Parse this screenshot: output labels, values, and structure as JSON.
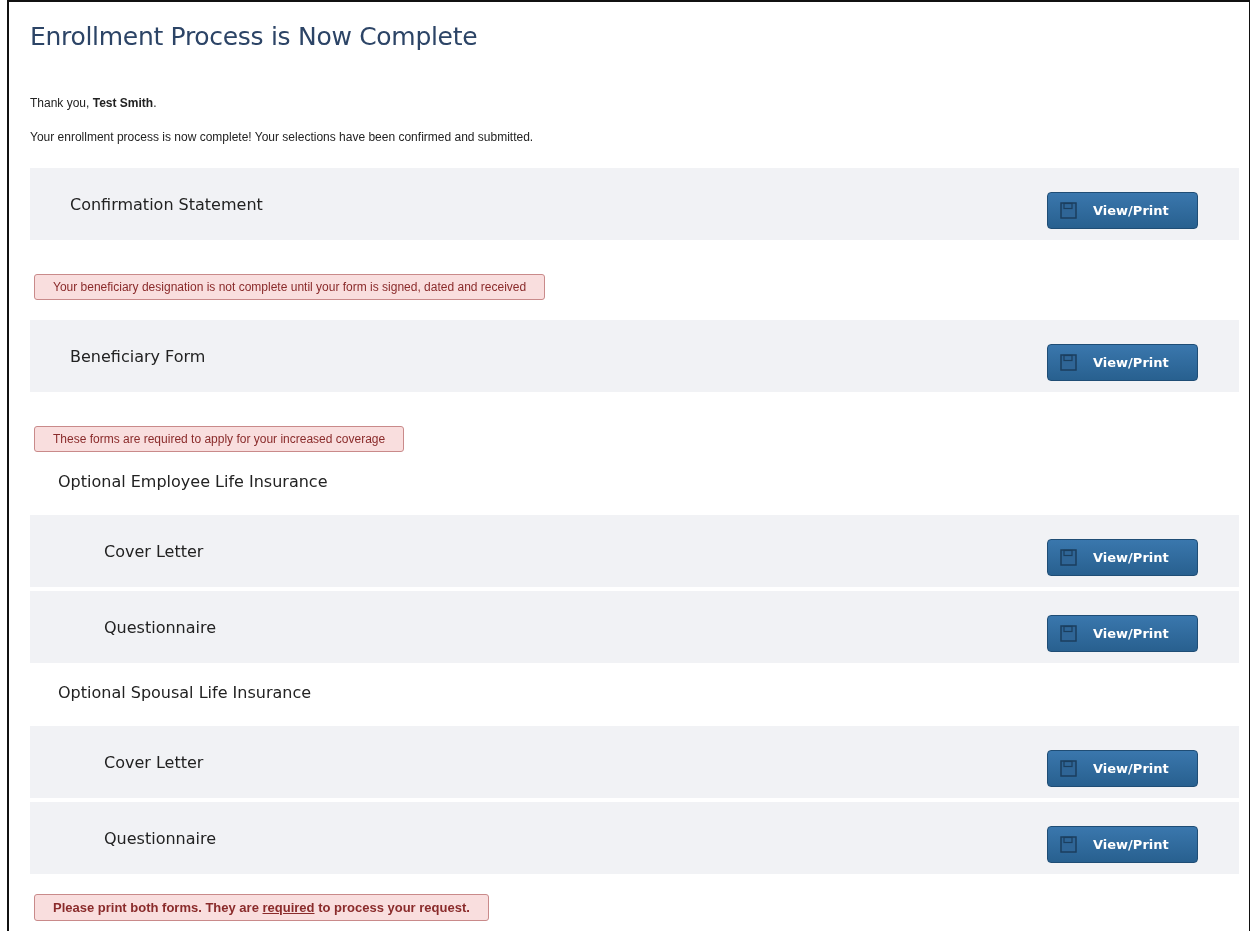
{
  "title": "Enrollment Process is Now Complete",
  "thanks": "Thank you, **Test Smith**.",
  "message": "Your enrollment process is now complete! Your selections have been confirmed and submitted.",
  "items": [
    {
      "kind": "document",
      "label": "Confirmation Statement",
      "button": "View/Print"
    },
    {
      "kind": "alert",
      "bold": false,
      "segments": [
        {
          "text": "Your beneficiary designation is not complete until your form is signed, dated and received",
          "underlined": false
        }
      ]
    },
    {
      "kind": "document",
      "label": "Beneficiary Form",
      "button": "View/Print"
    },
    {
      "kind": "alert",
      "bold": false,
      "segments": [
        {
          "text": "These forms are required to apply for your increased coverage",
          "underlined": false
        }
      ]
    },
    {
      "kind": "group",
      "label": "Optional Employee Life Insurance",
      "children": [
        {
          "kind": "document",
          "label": "Cover Letter",
          "button": "View/Print"
        },
        {
          "kind": "document",
          "label": "Questionnaire",
          "button": "View/Print"
        }
      ]
    },
    {
      "kind": "group",
      "label": "Optional Spousal Life Insurance",
      "children": [
        {
          "kind": "document",
          "label": "Cover Letter",
          "button": "View/Print"
        },
        {
          "kind": "document",
          "label": "Questionnaire",
          "button": "View/Print"
        }
      ]
    },
    {
      "kind": "alert",
      "bold": true,
      "segments": [
        {
          "text": "Please print both forms. They are ",
          "underlined": false
        },
        {
          "text": "required",
          "underlined": true
        },
        {
          "text": " to process your request.",
          "underlined": false
        }
      ]
    }
  ]
}
